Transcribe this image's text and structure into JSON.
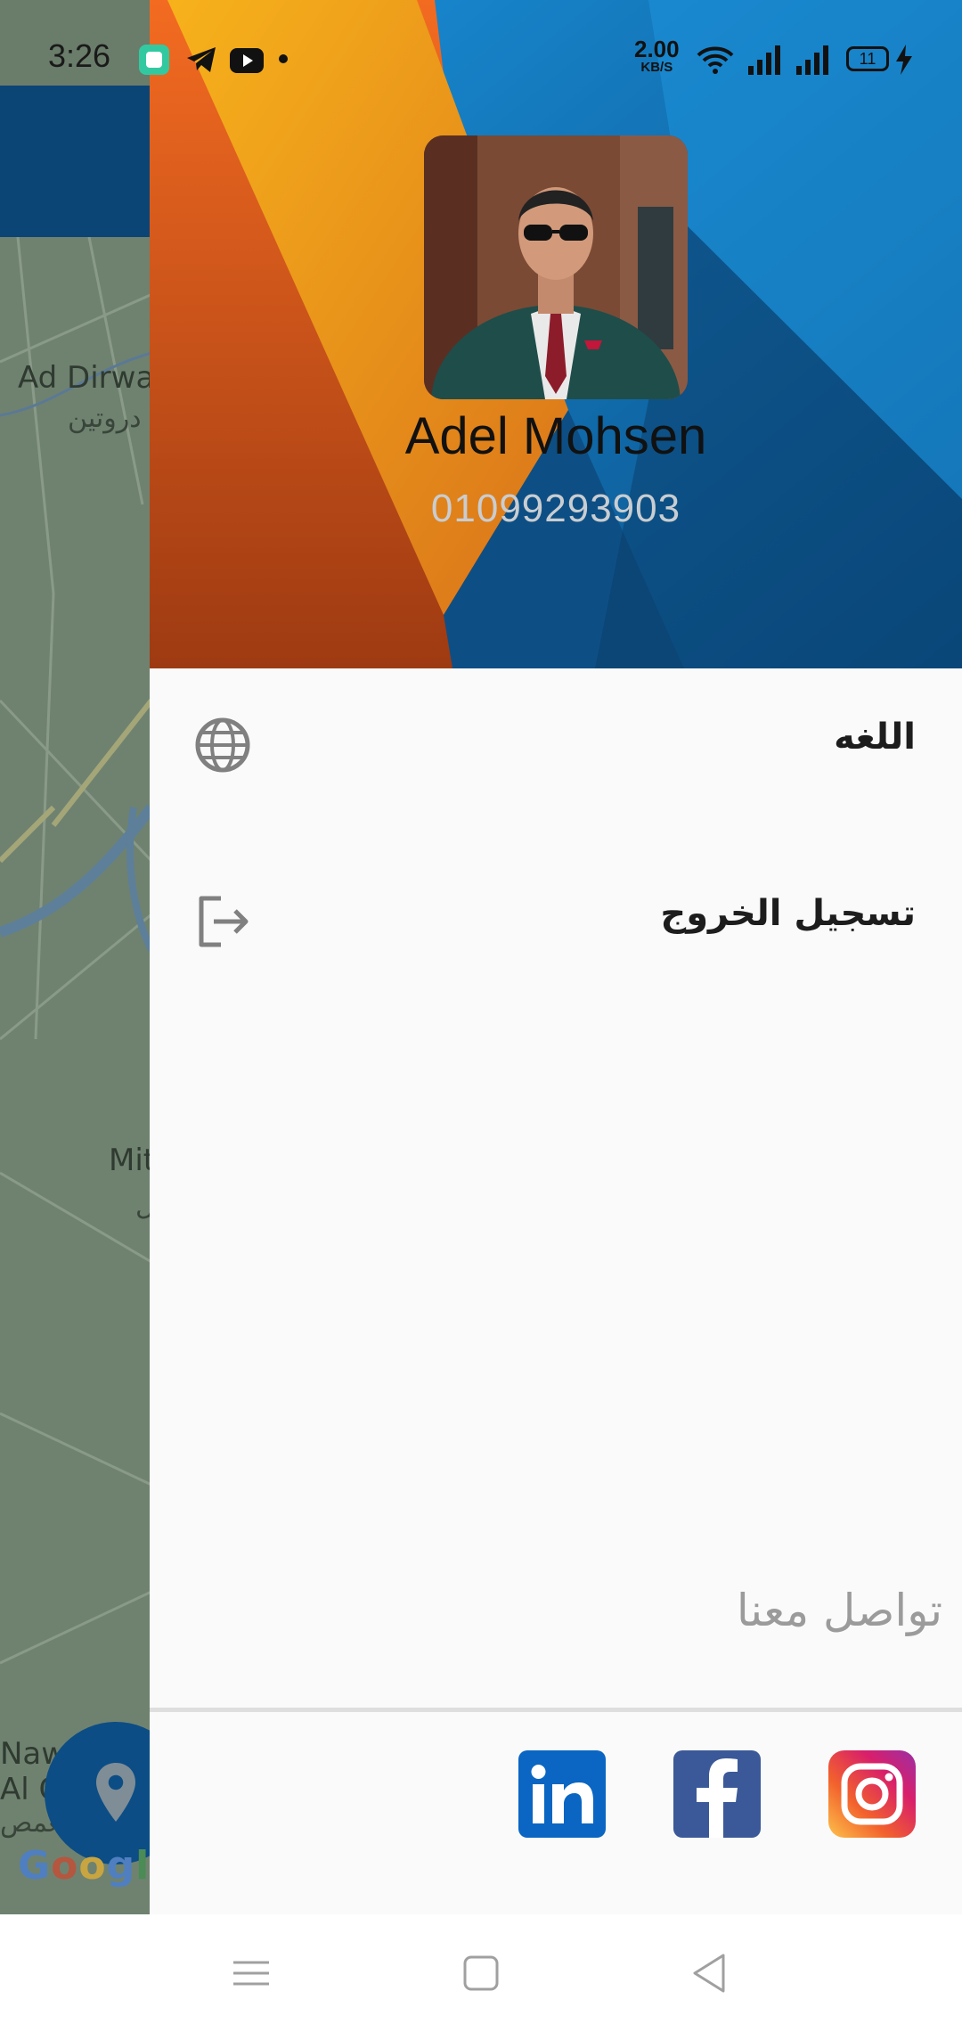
{
  "status_bar": {
    "time": "3:26",
    "net_speed_value": "2.00",
    "net_speed_unit": "KB/S",
    "battery_level": "11",
    "icons": [
      "notification-app-icon",
      "telegram-icon",
      "youtube-icon",
      "dot-icon",
      "wifi-icon",
      "signal-icon",
      "signal-icon",
      "battery-icon",
      "charging-icon"
    ]
  },
  "map": {
    "labels": [
      "Ad Dirwa",
      "دروتين",
      "Mit",
      "ل",
      "Naw",
      "Al G",
      "الغمص"
    ],
    "google_logo": "Google"
  },
  "drawer": {
    "profile": {
      "name": "Adel Mohsen",
      "phone": "01099293903"
    },
    "menu": [
      {
        "label": "اللغه",
        "icon": "globe-icon"
      },
      {
        "label": "تسجيل الخروج",
        "icon": "logout-icon"
      }
    ],
    "contact": {
      "title": "تواصل معنا",
      "links": [
        {
          "name": "linkedin",
          "icon": "linkedin-icon"
        },
        {
          "name": "facebook",
          "icon": "facebook-icon"
        },
        {
          "name": "instagram",
          "icon": "instagram-icon"
        }
      ]
    }
  },
  "nav_bar": {
    "buttons": [
      "menu-icon",
      "home-icon",
      "back-icon"
    ]
  },
  "colors": {
    "header_blue": "#0c5a93",
    "topbar_blue": "#0b4576",
    "orange": "#e9651f",
    "yellow": "#f4a51c",
    "fab_blue": "#0c4d85",
    "linkedin": "#0a66c2",
    "facebook": "#3b5998"
  }
}
